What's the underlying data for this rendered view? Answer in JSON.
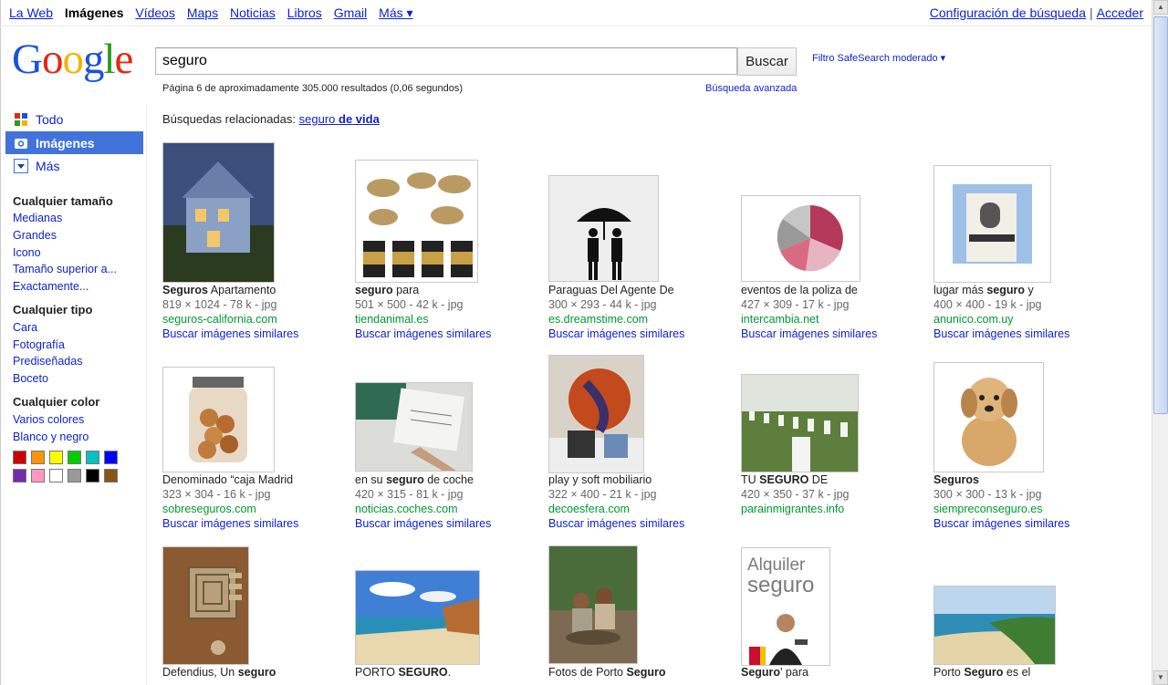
{
  "topnav": {
    "links": [
      "La Web",
      "Imágenes",
      "Vídeos",
      "Maps",
      "Noticias",
      "Libros",
      "Gmail",
      "Más ▾"
    ],
    "active_index": 1,
    "settings": "Configuración de búsqueda",
    "separator": "|",
    "signin": "Acceder"
  },
  "logo": {
    "letters": [
      "G",
      "o",
      "o",
      "g",
      "l",
      "e"
    ],
    "colors": [
      "#1a52e0",
      "#e32a14",
      "#f3b400",
      "#1a52e0",
      "#2a9b1c",
      "#e32a14"
    ]
  },
  "search": {
    "query": "seguro",
    "button": "Buscar",
    "safesearch": "Filtro SafeSearch moderado ▾"
  },
  "stats": {
    "text": "Página 6 de aproximadamente 305.000 resultados (0,06 segundos)",
    "advanced": "Búsqueda avanzada"
  },
  "sidebar": {
    "modes": [
      "Todo",
      "Imágenes",
      "Más"
    ],
    "size_head": "Cualquier tamaño",
    "sizes": [
      "Medianas",
      "Grandes",
      "Icono",
      "Tamaño superior a...",
      "Exactamente..."
    ],
    "type_head": "Cualquier tipo",
    "types": [
      "Cara",
      "Fotografía",
      "Prediseñadas",
      "Boceto"
    ],
    "color_head": "Cualquier color",
    "colors": [
      "Varios colores",
      "Blanco y negro"
    ],
    "swatches": [
      "#cc0000",
      "#fb940b",
      "#ffff00",
      "#00cc00",
      "#03c0c6",
      "#0000ff",
      "#762ca7",
      "#ff98bf",
      "#ffffff",
      "#999999",
      "#000000",
      "#885418"
    ]
  },
  "related": {
    "label": "Búsquedas relacionadas:",
    "link_plain": "seguro",
    "link_bold": "de vida"
  },
  "similar_label": "Buscar imágenes similares",
  "results": [
    {
      "t1": "Seguros",
      "t2": " Apartamento",
      "bold_first": true,
      "meta": "819 × 1024 - 78 k - jpg",
      "site": "seguros-california.com",
      "similar": true
    },
    {
      "t1": "seguro",
      "t2": " para",
      "bold_first": true,
      "meta": "501 × 500 - 42 k - jpg",
      "site": "tiendanimal.es",
      "similar": true
    },
    {
      "t1": "Paraguas Del Agente De",
      "t2": "",
      "bold_first": false,
      "meta": "300 × 293 - 44 k - jpg",
      "site": "es.dreamstime.com",
      "similar": true
    },
    {
      "t1": "eventos de la poliza de",
      "t2": "",
      "bold_first": false,
      "meta": "427 × 309 - 17 k - jpg",
      "site": "intercambia.net",
      "similar": true
    },
    {
      "t1": "lugar más ",
      "t2": "seguro",
      "t3": " y",
      "bold_first": false,
      "bold_second": true,
      "meta": "400 × 400 - 19 k - jpg",
      "site": "anunico.com.uy",
      "similar": true
    },
    {
      "t1": "Denominado “caja Madrid",
      "t2": "",
      "bold_first": false,
      "meta": "323 × 304 - 16 k - jpg",
      "site": "sobreseguros.com",
      "similar": true
    },
    {
      "t1": "en su ",
      "t2": "seguro",
      "t3": " de coche",
      "bold_first": false,
      "bold_second": true,
      "meta": "420 × 315 - 81 k - jpg",
      "site": "noticias.coches.com",
      "similar": true
    },
    {
      "t1": "play y soft mobiliario",
      "t2": "",
      "bold_first": false,
      "meta": "322 × 400 - 21 k - jpg",
      "site": "decoesfera.com",
      "similar": true
    },
    {
      "t1": "TU ",
      "t2": "SEGURO",
      "t3": " DE",
      "bold_first": false,
      "bold_second": true,
      "meta": "420 × 350 - 37 k - jpg",
      "site": "parainmigrantes.info",
      "similar": false
    },
    {
      "t1": "Seguros",
      "t2": "",
      "bold_first": true,
      "meta": "300 × 300 - 13 k - jpg",
      "site": "siempreconseguro.es",
      "similar": true
    },
    {
      "t1": "Defendius, Un ",
      "t2": "seguro",
      "t3": "",
      "bold_first": false,
      "bold_second": true,
      "meta": "",
      "site": "",
      "similar": false
    },
    {
      "t1": "PORTO ",
      "t2": "SEGURO",
      "t3": ".",
      "bold_first": false,
      "bold_second": true,
      "meta": "",
      "site": "",
      "similar": false
    },
    {
      "t1": "Fotos de Porto ",
      "t2": "Seguro",
      "t3": "",
      "bold_first": false,
      "bold_second": true,
      "meta": "",
      "site": "",
      "similar": false
    },
    {
      "t1": "Seguro",
      "t2": "' para",
      "bold_first": true,
      "meta": "",
      "site": "",
      "similar": false
    },
    {
      "t1": "Porto ",
      "t2": "Seguro",
      "t3": " es el",
      "bold_first": false,
      "bold_second": true,
      "meta": "",
      "site": "",
      "similar": false
    }
  ],
  "thumb_captions": {
    "alquiler_line1": "Alquiler",
    "alquiler_line2": "seguro"
  }
}
